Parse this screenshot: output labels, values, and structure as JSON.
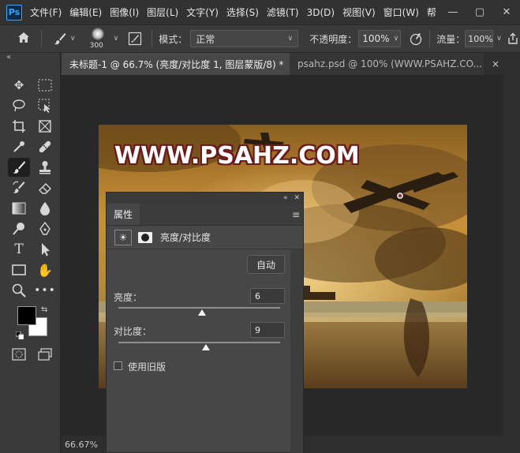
{
  "app": {
    "logo": "Ps"
  },
  "menu": [
    "文件(F)",
    "编辑(E)",
    "图像(I)",
    "图层(L)",
    "文字(Y)",
    "选择(S)",
    "滤镜(T)",
    "3D(D)",
    "视图(V)",
    "窗口(W)",
    "帮"
  ],
  "window_controls": {
    "minimize": "—",
    "restore": "▢",
    "close": "✕"
  },
  "options": {
    "brush_size": "300",
    "mode_label": "模式：",
    "mode_value": "正常",
    "opacity_label": "不透明度：",
    "opacity_value": "100%",
    "flow_label": "流量：",
    "flow_value": "100%"
  },
  "tabs": [
    {
      "label": "未标题-1 @ 66.7% (亮度/对比度 1, 图层蒙版/8) *",
      "close": "×"
    },
    {
      "label": "psahz.psd @ 100% (WWW.PSAHZ.CO...",
      "close": "×"
    }
  ],
  "canvas": {
    "watermark": "WWW.PSAHZ.COM"
  },
  "status": {
    "zoom": "66.67%"
  },
  "properties": {
    "tab": "属性",
    "title": "亮度/对比度",
    "auto_button": "自动",
    "brightness_label": "亮度：",
    "brightness_value": "6",
    "contrast_label": "对比度：",
    "contrast_value": "9",
    "legacy_label": "使用旧版"
  },
  "colors": {
    "foreground": "#000000",
    "background": "#ffffff",
    "accent": "#31a8ff"
  }
}
